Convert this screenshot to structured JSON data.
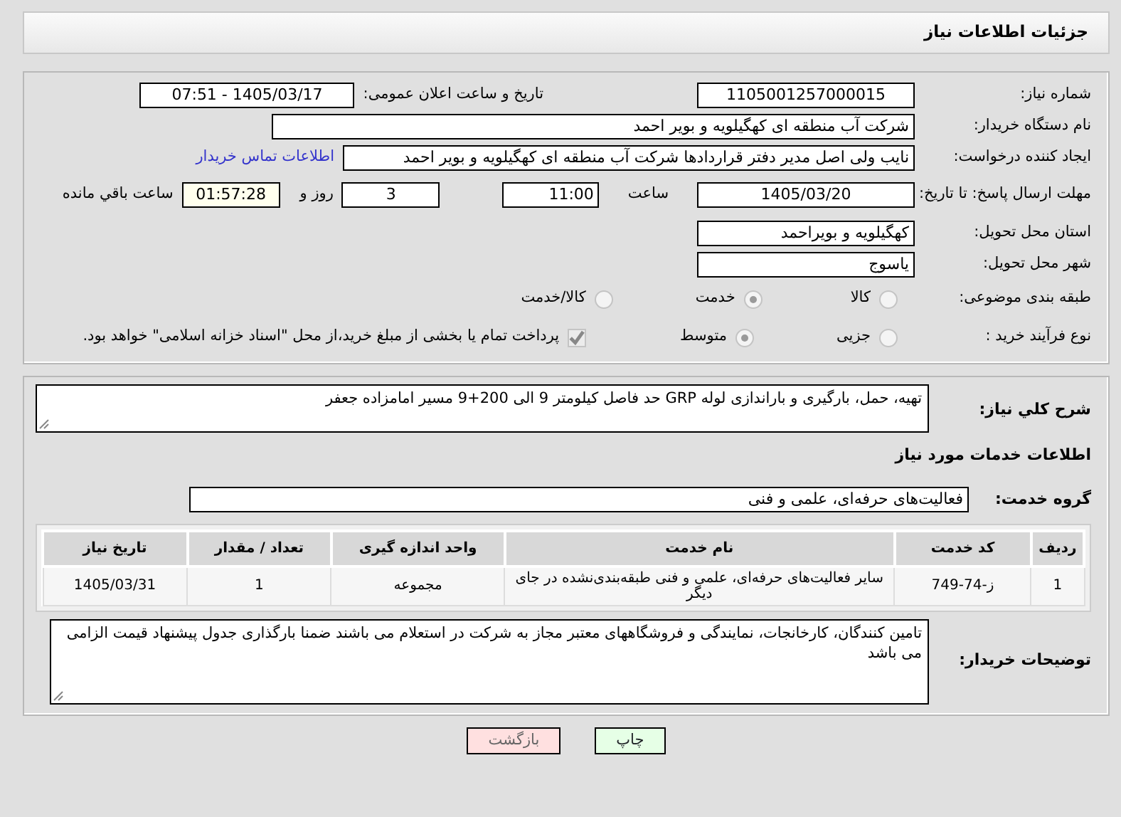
{
  "page_title": "جزئیات اطلاعات نیاز",
  "need_number": {
    "label": "شماره نیاز:",
    "value": "1105001257000015"
  },
  "announce": {
    "label": "تاریخ و ساعت اعلان عمومی:",
    "value": "1405/03/17 - 07:51"
  },
  "buyer": {
    "label": "نام دستگاه خریدار:",
    "value": "شرکت آب منطقه ای کهگیلویه و بویر احمد"
  },
  "creator": {
    "label": "ایجاد کننده درخواست:",
    "value": "نایب ولی اصل مدیر دفتر قراردادها شرکت آب منطقه ای کهگیلویه و بویر احمد",
    "link": "اطلاعات تماس خریدار"
  },
  "deadline": {
    "label": "مهلت ارسال پاسخ: تا تاریخ:",
    "date": "1405/03/20",
    "time_label": "ساعت",
    "time": "11:00",
    "days": "3",
    "days_label": "روز و",
    "remaining": "01:57:28",
    "remaining_label": "ساعت باقي مانده"
  },
  "province": {
    "label": "استان محل تحویل:",
    "value": "کهگیلویه و بویراحمد"
  },
  "city": {
    "label": "شهر محل تحویل:",
    "value": "یاسوج"
  },
  "category": {
    "label": "طبقه بندی موضوعی:",
    "options": [
      {
        "label": "کالا",
        "selected": false
      },
      {
        "label": "خدمت",
        "selected": true
      },
      {
        "label": "کالا/خدمت",
        "selected": false
      }
    ]
  },
  "process": {
    "label": "نوع فرآیند خرید :",
    "options": [
      {
        "label": "جزیی",
        "selected": false
      },
      {
        "label": "متوسط",
        "selected": true
      }
    ],
    "treasury": {
      "label": "پرداخت تمام یا بخشی از مبلغ خرید،از محل \"اسناد خزانه اسلامی\" خواهد بود.",
      "checked": true,
      "disabled": true
    }
  },
  "description": {
    "label": "شرح کلي نياز:",
    "value": "تهیه، حمل، بارگیری و باراندازی لوله GRP حد فاصل کیلومتر 9 الی 200+9 مسیر امامزاده جعفر"
  },
  "services_heading": "اطلاعات خدمات مورد نياز",
  "service_group": {
    "label": "گروه خدمت:",
    "value": "فعالیت‌های حرفه‌ای، علمی و فنی"
  },
  "table": {
    "columns": [
      "ردیف",
      "کد خدمت",
      "نام خدمت",
      "واحد اندازه گیری",
      "تعداد / مقدار",
      "تاریخ نیاز"
    ],
    "rows": [
      [
        "1",
        "ز-74-749",
        "سایر فعالیت‌های حرفه‌ای، علمی و فنی طبقه‌بندی‌نشده در جای دیگر",
        "مجموعه",
        "1",
        "1405/03/31"
      ]
    ]
  },
  "buyer_notes": {
    "label": "توضیحات خریدار:",
    "value": "تامین کنندگان، کارخانجات، نمایندگی و فروشگاههای معتبر مجاز به شرکت در استعلام می باشند ضمنا بارگذاری جدول پیشنهاد قیمت الزامی می باشد"
  },
  "buttons": [
    {
      "label": "چاپ",
      "kind": "print"
    },
    {
      "label": "بازگشت",
      "kind": "back"
    }
  ]
}
